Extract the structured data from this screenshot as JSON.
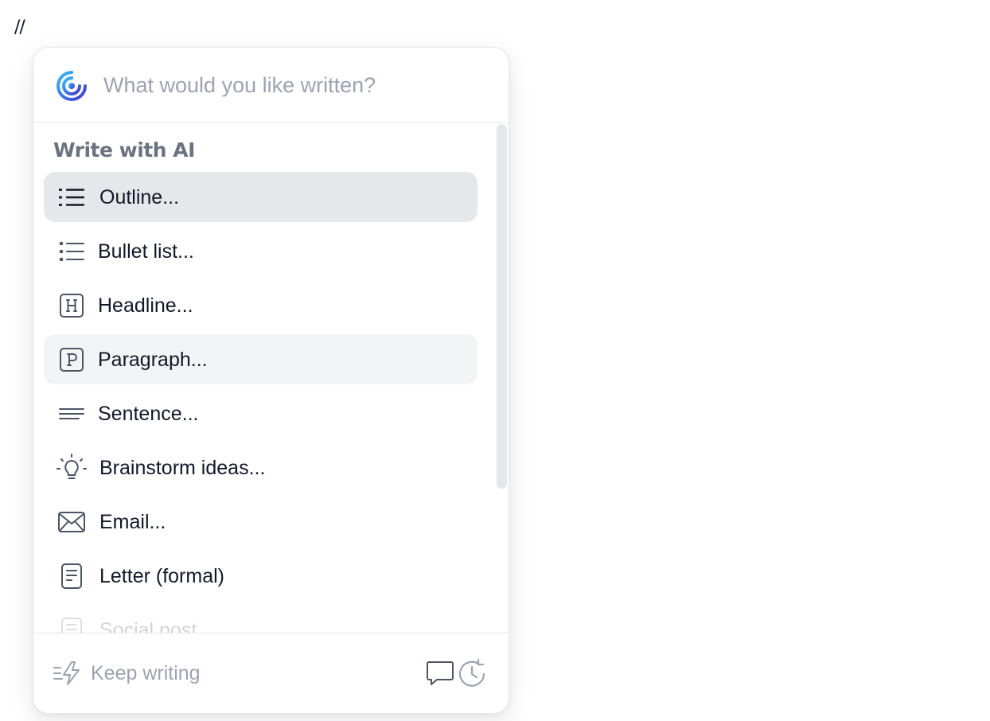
{
  "editor": {
    "trigger_text": "//"
  },
  "prompt": {
    "placeholder": "What would you like written?",
    "logo_icon": "ai-assistant-logo-icon"
  },
  "section": {
    "title": "Write with AI"
  },
  "items": [
    {
      "label": "Outline...",
      "icon": "outline-list-icon",
      "state": "selected"
    },
    {
      "label": "Bullet list...",
      "icon": "bullet-list-icon",
      "state": "normal"
    },
    {
      "label": "Headline...",
      "icon": "headline-h-icon",
      "state": "normal"
    },
    {
      "label": "Paragraph...",
      "icon": "paragraph-p-icon",
      "state": "hover"
    },
    {
      "label": "Sentence...",
      "icon": "sentence-lines-icon",
      "state": "normal"
    },
    {
      "label": "Brainstorm ideas...",
      "icon": "lightbulb-icon",
      "state": "normal"
    },
    {
      "label": "Email...",
      "icon": "envelope-icon",
      "state": "normal"
    },
    {
      "label": "Letter (formal)",
      "icon": "document-icon",
      "state": "normal"
    },
    {
      "label": "Social post",
      "icon": "social-post-icon",
      "state": "faded"
    }
  ],
  "footer": {
    "keep_writing_label": "Keep writing",
    "keep_writing_icon": "lines-lightning-icon",
    "comment_icon": "speech-bubble-icon",
    "history_icon": "history-clock-icon"
  },
  "colors": {
    "accent_start": "#0ea5e9",
    "accent_end": "#4f46e5",
    "selected_bg": "#e5e7eb",
    "hover_bg": "#f3f4f6"
  }
}
